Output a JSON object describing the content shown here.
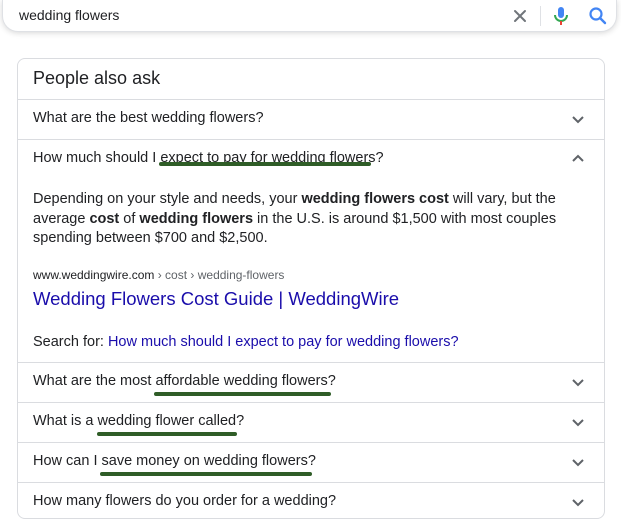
{
  "search": {
    "query": "wedding flowers"
  },
  "paa": {
    "title": "People also ask",
    "questions": [
      {
        "text": "What are the best wedding flowers?"
      },
      {
        "text": "How much should I expect to pay for wedding flowers?"
      },
      {
        "text": "What are the most affordable wedding flowers?"
      },
      {
        "text": "What is a wedding flower called?"
      },
      {
        "text": "How can I save money on wedding flowers?"
      },
      {
        "text": "How many flowers do you order for a wedding?"
      }
    ],
    "expanded_index": 1,
    "answer": {
      "p1": "Depending on your style and needs, your ",
      "b1": "wedding flowers cost",
      "p2": " will vary, but the average ",
      "b2": "cost",
      "p3": " of ",
      "b3": "wedding flowers",
      "p4": " in the U.S. is around $1,500 with most couples spending between $700 and $2,500."
    },
    "source": {
      "domain": "www.weddingwire.com",
      "path": " › cost › wedding-flowers",
      "title": "Wedding Flowers Cost Guide | WeddingWire"
    },
    "search_for": {
      "label": "Search for: ",
      "query": "How much should I expect to pay for wedding flowers?"
    }
  },
  "colors": {
    "link": "#1a0dab",
    "marker": "#2f5d27",
    "mic_blue": "#4285f4",
    "mic_red": "#ea4335"
  },
  "icons": {
    "clear": "close-icon",
    "mic": "microphone-icon",
    "search": "search-icon",
    "collapse": "chevron-up-icon",
    "expand": "chevron-down-icon"
  }
}
